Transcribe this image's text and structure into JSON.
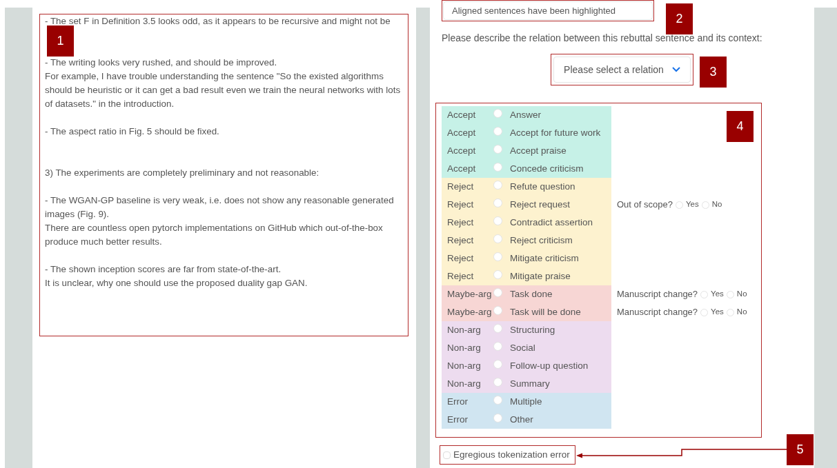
{
  "review_text": {
    "sections": [
      {
        "blocks": [
          [
            "- The set F in Definition 3.5 looks odd, as it appears to be recursive and might not be"
          ],
          [
            "- The writing looks very rushed, and should be improved.",
            "For example, I have trouble understanding the sentence \"So the existed algorithms should be heuristic or it can get a bad result even we train the neural networks with lots of datasets.\" in the introduction."
          ],
          [
            "- The aspect ratio in Fig. 5 should be fixed."
          ]
        ]
      },
      {
        "blocks": [
          [
            "3) The experiments are completely preliminary and not reasonable:"
          ],
          [
            "- The WGAN-GP baseline is very weak, i.e. does not show any reasonable generated images (Fig. 9).",
            "There are countless open pytorch implementations on GitHub which out-of-the-box produce much better results."
          ],
          [
            "- The shown inception scores are far from state-of-the-art.",
            "It is unclear, why one should use the proposed duality gap GAN."
          ]
        ]
      }
    ]
  },
  "alignment_select": {
    "value": "Aligned sentences have been highlighted"
  },
  "prompt": "Please describe the relation between this rebuttal sentence and its context:",
  "relation_select": {
    "placeholder": "Please select a relation"
  },
  "relations": [
    {
      "group": "Accept",
      "label": "Answer",
      "color": "#c6f1e7",
      "selected": false
    },
    {
      "group": "Accept",
      "label": "Accept for future work",
      "color": "#c6f1e7",
      "selected": false
    },
    {
      "group": "Accept",
      "label": "Accept praise",
      "color": "#c6f1e7",
      "selected": false
    },
    {
      "group": "Accept",
      "label": "Concede criticism",
      "color": "#c6f1e7",
      "selected": false
    },
    {
      "group": "Reject",
      "label": "Refute question",
      "color": "#fdf2cf",
      "selected": false
    },
    {
      "group": "Reject",
      "label": "Reject request",
      "color": "#fdf2cf",
      "selected": false,
      "followup": {
        "question": "Out of scope?",
        "options": [
          {
            "label": "Yes",
            "selected": false
          },
          {
            "label": "No",
            "selected": false
          }
        ]
      }
    },
    {
      "group": "Reject",
      "label": "Contradict assertion",
      "color": "#fdf2cf",
      "selected": false
    },
    {
      "group": "Reject",
      "label": "Reject criticism",
      "color": "#fdf2cf",
      "selected": false
    },
    {
      "group": "Reject",
      "label": "Mitigate criticism",
      "color": "#fdf2cf",
      "selected": false
    },
    {
      "group": "Reject",
      "label": "Mitigate praise",
      "color": "#fdf2cf",
      "selected": false
    },
    {
      "group": "Maybe-arg",
      "label": "Task done",
      "color": "#f7d6d4",
      "selected": false,
      "followup": {
        "question": "Manuscript change?",
        "options": [
          {
            "label": "Yes",
            "selected": false
          },
          {
            "label": "No",
            "selected": false
          }
        ]
      }
    },
    {
      "group": "Maybe-arg",
      "label": "Task will be done",
      "color": "#f7d6d4",
      "selected": false,
      "followup": {
        "question": "Manuscript change?",
        "options": [
          {
            "label": "Yes",
            "selected": false
          },
          {
            "label": "No",
            "selected": false
          }
        ]
      }
    },
    {
      "group": "Non-arg",
      "label": "Structuring",
      "color": "#eddcef",
      "selected": false
    },
    {
      "group": "Non-arg",
      "label": "Social",
      "color": "#eddcef",
      "selected": false
    },
    {
      "group": "Non-arg",
      "label": "Follow-up question",
      "color": "#eddcef",
      "selected": false
    },
    {
      "group": "Non-arg",
      "label": "Summary",
      "color": "#eddcef",
      "selected": false
    },
    {
      "group": "Error",
      "label": "Multiple",
      "color": "#d0e5f1",
      "selected": false
    },
    {
      "group": "Error",
      "label": "Other",
      "color": "#d0e5f1",
      "selected": false
    }
  ],
  "tokenization_error": {
    "label": "Egregious tokenization error",
    "checked": false
  },
  "annotations": [
    "1",
    "2",
    "3",
    "4",
    "5"
  ]
}
